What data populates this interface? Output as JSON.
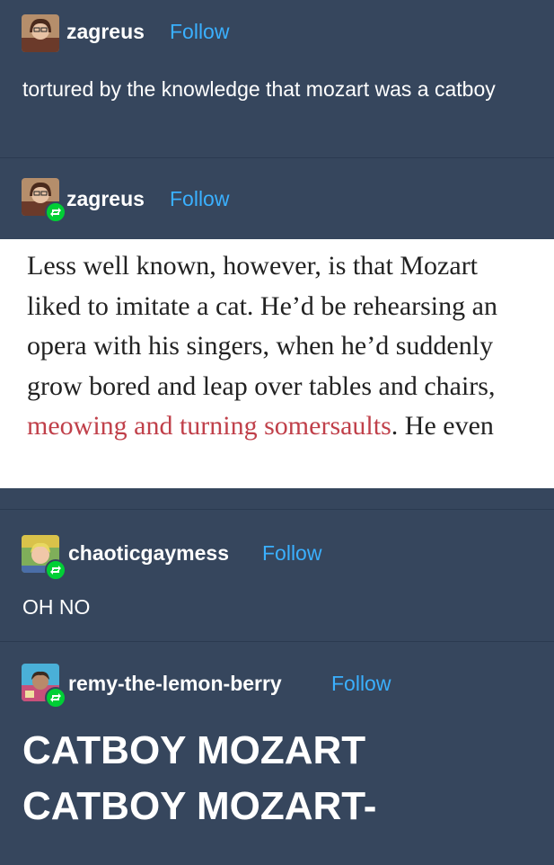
{
  "posts": [
    {
      "username": "zagreus",
      "follow_label": "Follow",
      "text": "tortured by the knowledge that mozart was a catboy"
    },
    {
      "username": "zagreus",
      "follow_label": "Follow",
      "quote": {
        "text_plain": "Less well known, however, is that Mozart liked to imitate a cat. He’d be rehearsing an opera with his singers, when he’d suddenly grow bored and leap over tables and chairs, ",
        "text_highlight": "meowing and turning somersaults",
        "text_tail": ". He even"
      }
    },
    {
      "username": "chaoticgaymess",
      "follow_label": "Follow",
      "text": "OH NO"
    },
    {
      "username": "remy-the-lemon-berry",
      "follow_label": "Follow",
      "text_line1": "CATBOY MOZART",
      "text_line2": "CATBOY MOZART-"
    }
  ],
  "colors": {
    "background": "#36465d",
    "follow": "#3ab0ff",
    "reblog_badge": "#00cf35",
    "highlight": "#c0404a"
  },
  "icons": {
    "reblog": "reblog-icon",
    "avatar": "avatar"
  }
}
